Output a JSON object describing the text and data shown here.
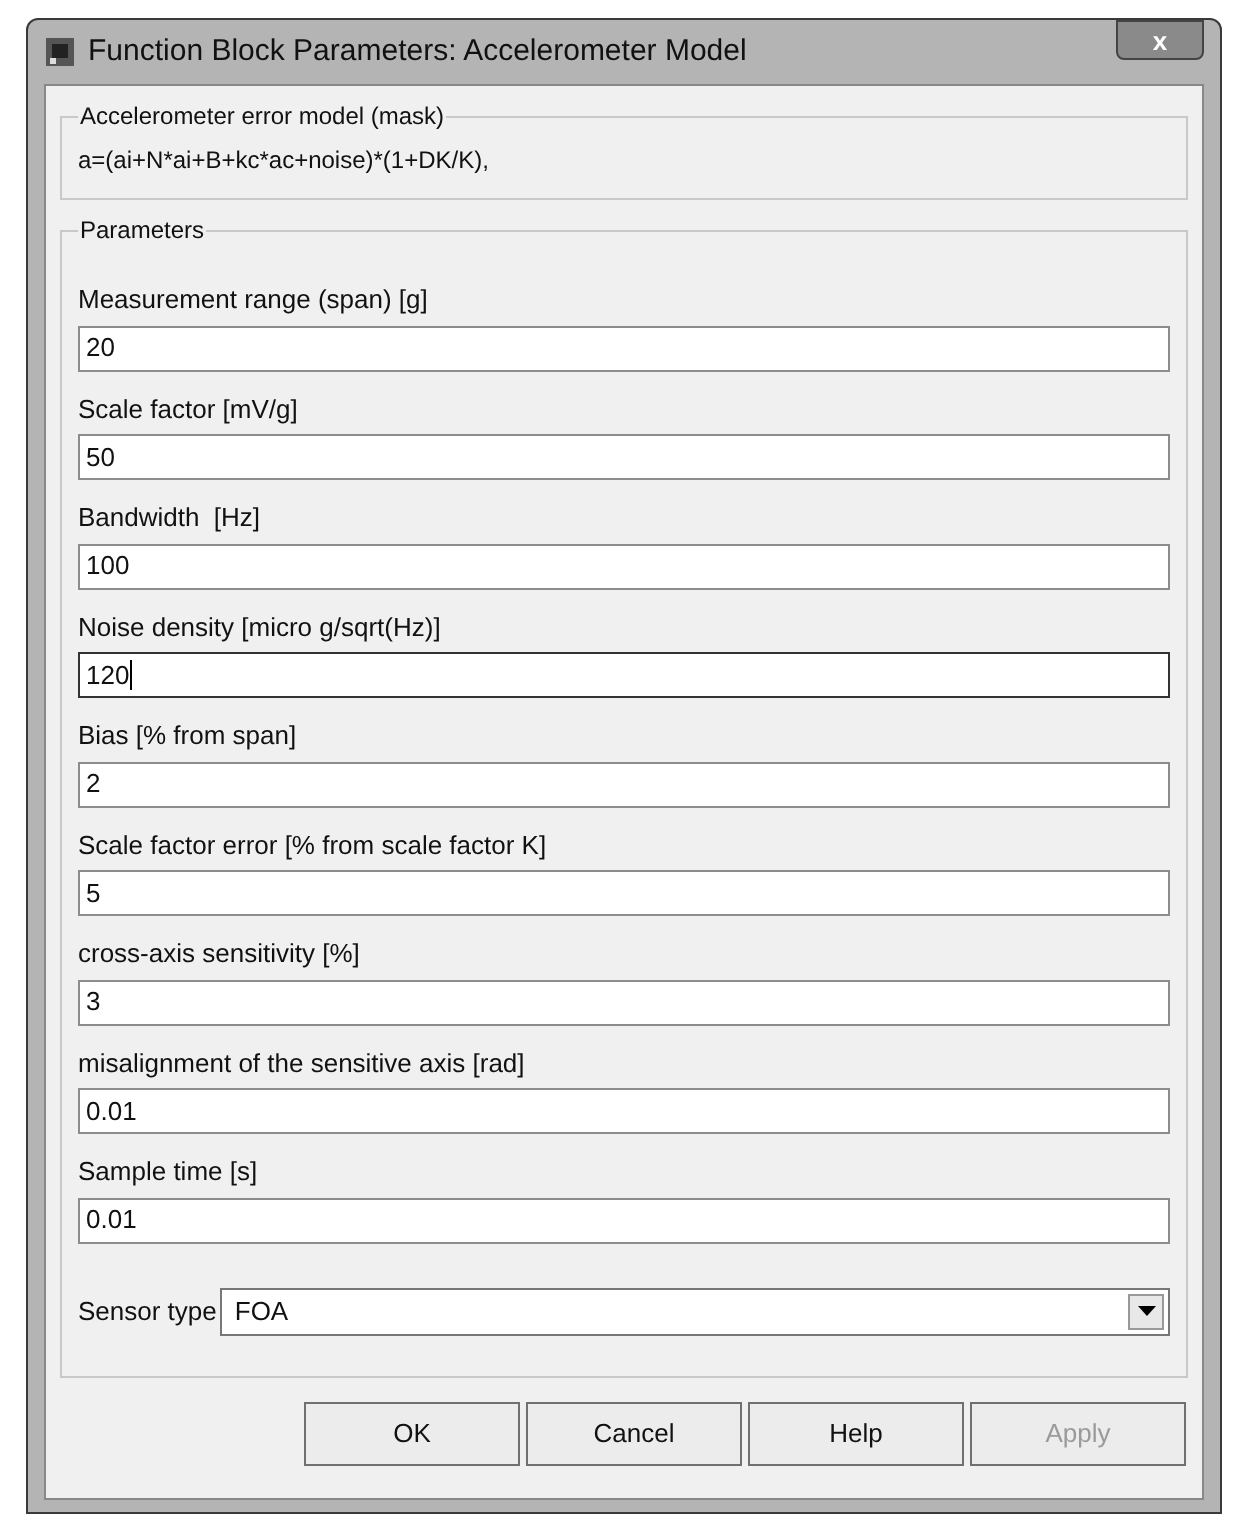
{
  "window": {
    "title": "Function Block Parameters: Accelerometer Model",
    "close": "x"
  },
  "description": {
    "title": "Accelerometer error model (mask)",
    "text": "a=(ai+N*ai+B+kc*ac+noise)*(1+DK/K),"
  },
  "parameters": {
    "title": "Parameters",
    "fields": [
      {
        "label": "Measurement range (span) [g]",
        "value": "20",
        "focused": false
      },
      {
        "label": "Scale factor [mV/g]",
        "value": "50",
        "focused": false
      },
      {
        "label": "Bandwidth  [Hz]",
        "value": "100",
        "focused": false
      },
      {
        "label": "Noise density [micro g/sqrt(Hz)]",
        "value": "120",
        "focused": true
      },
      {
        "label": "Bias [% from span]",
        "value": "2",
        "focused": false
      },
      {
        "label": "Scale factor error [% from scale factor K]",
        "value": "5",
        "focused": false
      },
      {
        "label": "cross-axis sensitivity [%]",
        "value": "3",
        "focused": false
      },
      {
        "label": "misalignment of the sensitive axis [rad]",
        "value": "0.01",
        "focused": false
      },
      {
        "label": "Sample time [s]",
        "value": "0.01",
        "focused": false
      }
    ],
    "sensor_type": {
      "label": "Sensor type",
      "value": "FOA"
    }
  },
  "buttons": [
    {
      "label": "OK",
      "disabled": false
    },
    {
      "label": "Cancel",
      "disabled": false
    },
    {
      "label": "Help",
      "disabled": false
    },
    {
      "label": "Apply",
      "disabled": true
    }
  ]
}
